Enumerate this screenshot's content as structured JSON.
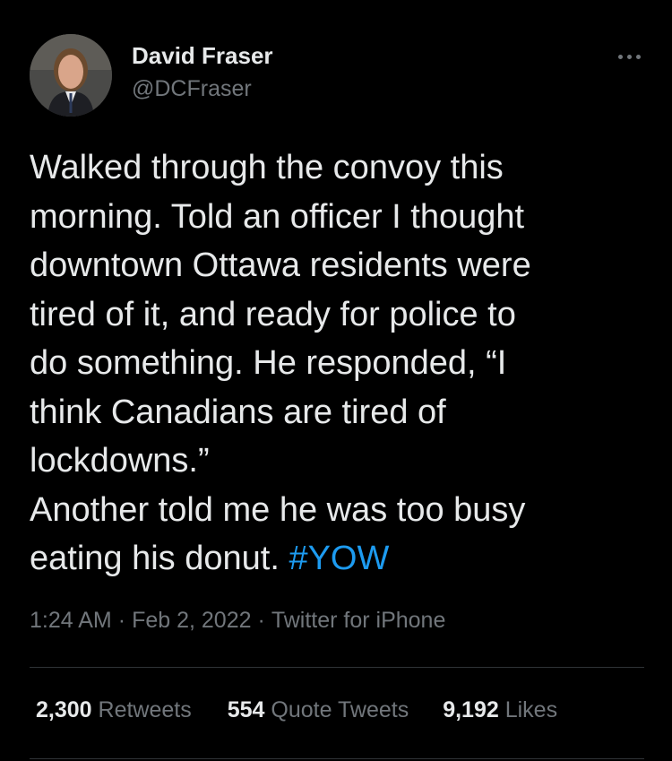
{
  "author": {
    "name": "David Fraser",
    "handle": "@DCFraser"
  },
  "tweet": {
    "lines": [
      "Walked through the convoy this",
      "morning. Told an officer I thought",
      "downtown Ottawa residents were",
      "tired of it, and ready for police to",
      "do something. He responded, “I",
      "think Canadians are tired of",
      "lockdowns.”",
      "Another told me he was too busy"
    ],
    "last_line_text": "eating his donut. ",
    "hashtag": "#YOW"
  },
  "meta": {
    "time": "1:24 AM",
    "separator": "·",
    "date": "Feb 2, 2022",
    "source": "Twitter for iPhone"
  },
  "stats": {
    "retweets_count": "2,300",
    "retweets_label": "Retweets",
    "quotes_count": "554",
    "quotes_label": "Quote Tweets",
    "likes_count": "9,192",
    "likes_label": "Likes"
  },
  "colors": {
    "background": "#000000",
    "text": "#e7e9ea",
    "secondary": "#71767b",
    "accent": "#1d9bf0",
    "divider": "#2f3336"
  },
  "icons": {
    "more": "more-horizontal-icon"
  }
}
